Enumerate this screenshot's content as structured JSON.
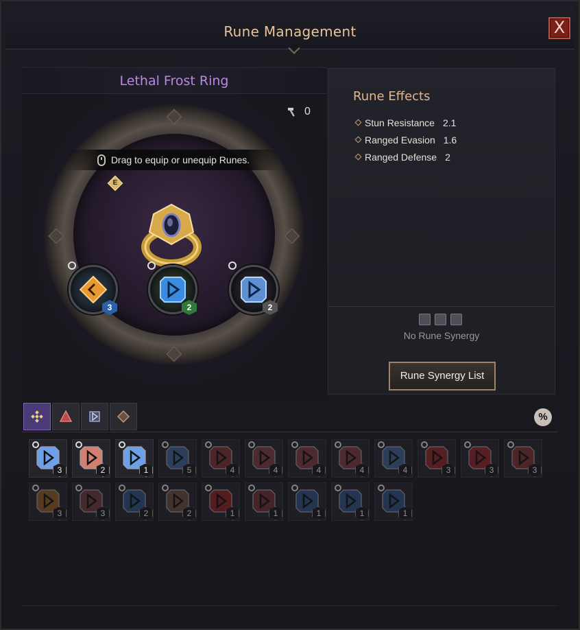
{
  "window": {
    "title": "Rune Management",
    "close_glyph": "X"
  },
  "equipment": {
    "item_name": "Lethal Frost Ring",
    "hammer_count": "0",
    "hint": "Drag to equip or unequip Runes.",
    "marker_letter": "E",
    "slots": [
      {
        "level": "3",
        "color": "#e08a2a",
        "level_bg": "#2b5fa8"
      },
      {
        "level": "2",
        "color": "#4aa0e8",
        "level_bg": "#2f7a3a"
      },
      {
        "level": "2",
        "color": "#6a9ae0",
        "level_bg": "#555558"
      }
    ]
  },
  "effects": {
    "title": "Rune Effects",
    "items": [
      {
        "label": "Stun Resistance",
        "value": "2.1"
      },
      {
        "label": "Ranged Evasion",
        "value": "1.6"
      },
      {
        "label": "Ranged Defense",
        "value": "2"
      }
    ],
    "no_synergy": "No Rune Synergy",
    "synergy_button": "Rune Synergy List"
  },
  "tabs": [
    {
      "name": "all",
      "active": true
    },
    {
      "name": "red",
      "active": false
    },
    {
      "name": "blue",
      "active": false
    },
    {
      "name": "brown",
      "active": false
    }
  ],
  "percent_label": "%",
  "inventory": {
    "row1": [
      {
        "level": "3",
        "color": "#6ea0e8"
      },
      {
        "level": "2",
        "color": "#d08070"
      },
      {
        "level": "1",
        "color": "#6ea0e8"
      },
      {
        "level": "5",
        "color": "#3d5d8a"
      },
      {
        "level": "4",
        "color": "#7a3030"
      },
      {
        "level": "4",
        "color": "#7a3a3a"
      },
      {
        "level": "4",
        "color": "#7a3a3a"
      },
      {
        "level": "4",
        "color": "#7a3a3a"
      },
      {
        "level": "4",
        "color": "#3d5d8a"
      },
      {
        "level": "3",
        "color": "#8a2525"
      },
      {
        "level": "3",
        "color": "#8a2525"
      },
      {
        "level": "3",
        "color": "#7a3030"
      }
    ],
    "row2": [
      {
        "level": "3",
        "color": "#8a5a20"
      },
      {
        "level": "3",
        "color": "#6a3a3a"
      },
      {
        "level": "2",
        "color": "#2d4f7a"
      },
      {
        "level": "2",
        "color": "#6a4a3a"
      },
      {
        "level": "1",
        "color": "#8a2020"
      },
      {
        "level": "1",
        "color": "#6a3030"
      },
      {
        "level": "1",
        "color": "#2d4f7a"
      },
      {
        "level": "1",
        "color": "#2d4f7a"
      },
      {
        "level": "1",
        "color": "#2d4f7a"
      }
    ]
  }
}
